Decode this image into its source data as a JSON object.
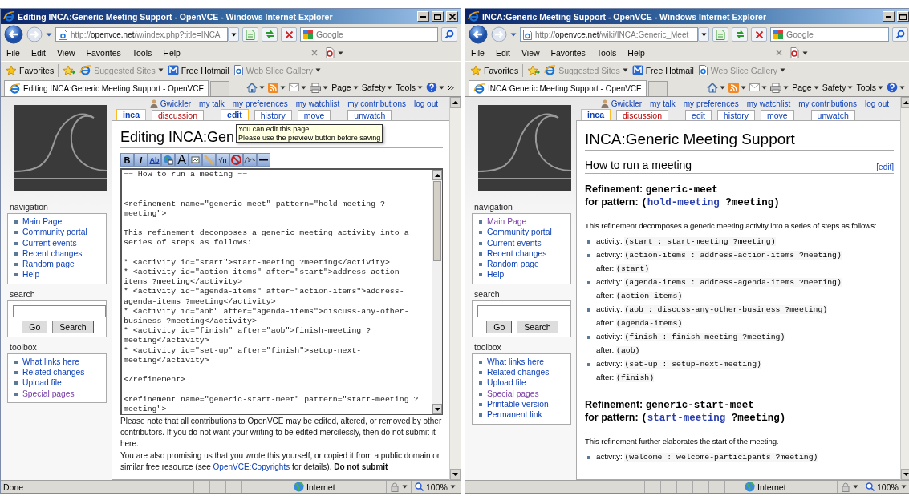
{
  "windows": [
    {
      "kind": "edit",
      "title": "Editing INCA:Generic Meeting Support - OpenVCE - Windows Internet Explorer",
      "address": {
        "prefix": "http://",
        "host": "openvce.net",
        "path": "/w/index.php?title=INCA"
      },
      "search_placeholder": "Google",
      "menu": [
        "File",
        "Edit",
        "View",
        "Favorites",
        "Tools",
        "Help"
      ],
      "favorites": "Favorites",
      "favorite_links": [
        {
          "kind": "suggested",
          "label": "Suggested Sites",
          "disabled": true
        },
        {
          "kind": "hotmail",
          "label": "Free Hotmail",
          "disabled": false
        },
        {
          "kind": "webslice",
          "label": "Web Slice Gallery",
          "disabled": true
        }
      ],
      "tab_title": "Editing INCA:Generic Meeting Support - OpenVCE",
      "commands": [
        "Page",
        "Safety",
        "Tools"
      ],
      "user_links": [
        "Gwickler",
        "my talk",
        "my preferences",
        "my watchlist",
        "my contributions",
        "log out"
      ],
      "page_tabs": [
        {
          "label": "inca",
          "selected": true,
          "new": false
        },
        {
          "label": "discussion",
          "selected": false,
          "new": true
        },
        {
          "label": "edit",
          "selected": true,
          "new": false
        },
        {
          "label": "history",
          "selected": false,
          "new": false
        },
        {
          "label": "move",
          "selected": false,
          "new": false
        },
        {
          "label": "unwatch",
          "selected": false,
          "new": false
        }
      ],
      "heading": "Editing INCA:Gen",
      "tooltip": [
        "You can edit this page.",
        "Please use the preview button before saving"
      ],
      "toolbar": [
        {
          "kind": "bold",
          "glyph": "B"
        },
        {
          "kind": "italic",
          "glyph": "I"
        },
        {
          "kind": "link",
          "glyph": "Ab"
        },
        {
          "kind": "extlink"
        },
        {
          "kind": "headline",
          "glyph": "A"
        },
        {
          "kind": "image"
        },
        {
          "kind": "media"
        },
        {
          "kind": "math",
          "glyph": "√n"
        },
        {
          "kind": "nowiki"
        },
        {
          "kind": "signature"
        },
        {
          "kind": "rule"
        }
      ],
      "editor_paragraphs": [
        {
          "kind": "heading",
          "lines": [
            "== How to run a meeting =="
          ]
        },
        {
          "kind": "block",
          "lines": [
            "<refinement name=\"generic-meet\" pattern=\"hold-meeting ?",
            "meeting\">"
          ]
        },
        {
          "kind": "block",
          "lines": [
            "This refinement decomposes a generic meeting activity into a",
            "series of steps as follows:"
          ]
        },
        {
          "kind": "block",
          "lines": [
            "* <activity id=\"start\">start-meeting ?meeting</activity>",
            "* <activity id=\"action-items\" after=\"start\">address-action-",
            "items ?meeting</activity>",
            "* <activity id=\"agenda-items\" after=\"action-items\">address-",
            "agenda-items ?meeting</activity>",
            "* <activity id=\"aob\" after=\"agenda-items\">discuss-any-other-",
            "business ?meeting</activity>",
            "* <activity id=\"finish\" after=\"aob\">finish-meeting ?",
            "meeting</activity>",
            "* <activity id=\"set-up\" after=\"finish\">setup-next-",
            "meeting</activity>"
          ]
        },
        {
          "kind": "block",
          "lines": [
            "</refinement>"
          ]
        },
        {
          "kind": "block",
          "lines": [
            "<refinement name=\"generic-start-meet\" pattern=\"start-meeting ?",
            "meeting\">"
          ]
        }
      ],
      "notice": [
        {
          "text": "Please note that all contributions to OpenVCE may be edited, altered, or removed by other contributors. If you do not want your writing to be edited mercilessly, then do not submit it here."
        },
        {
          "text": "You are also promising us that you wrote this yourself, or copied it from a public domain or similar free resource (see ",
          "link": "OpenVCE:Copyrights",
          "after": " for details). **Do not submit**"
        }
      ],
      "sidebar": {
        "navigation": {
          "title": "navigation",
          "items": [
            {
              "label": "Main Page",
              "visited": false
            },
            {
              "label": "Community portal",
              "visited": false
            },
            {
              "label": "Current events",
              "visited": false
            },
            {
              "label": "Recent changes",
              "visited": false
            },
            {
              "label": "Random page",
              "visited": false
            },
            {
              "label": "Help",
              "visited": false
            }
          ]
        },
        "search": {
          "title": "search",
          "buttons": [
            "Go",
            "Search"
          ]
        },
        "toolbox": {
          "title": "toolbox",
          "items": [
            {
              "label": "What links here",
              "visited": false
            },
            {
              "label": "Related changes",
              "visited": false
            },
            {
              "label": "Upload file",
              "visited": false
            },
            {
              "label": "Special pages",
              "visited": true
            }
          ]
        }
      },
      "status": {
        "text": "Done",
        "zone": "Internet",
        "zoom": "100%"
      }
    },
    {
      "kind": "article",
      "title": "INCA:Generic Meeting Support - OpenVCE - Windows Internet Explorer",
      "address": {
        "prefix": "http://",
        "host": "openvce.net",
        "path": "/wiki/INCA:Generic_Meet"
      },
      "search_placeholder": "Google",
      "menu": [
        "File",
        "Edit",
        "View",
        "Favorites",
        "Tools",
        "Help"
      ],
      "favorites": "Favorites",
      "favorite_links": [
        {
          "kind": "suggested",
          "label": "Suggested Sites",
          "disabled": true
        },
        {
          "kind": "hotmail",
          "label": "Free Hotmail",
          "disabled": false
        },
        {
          "kind": "webslice",
          "label": "Web Slice Gallery",
          "disabled": true
        }
      ],
      "tab_title": "INCA:Generic Meeting Support - OpenVCE",
      "commands": [
        "Page",
        "Safety",
        "Tools"
      ],
      "user_links": [
        "Gwickler",
        "my talk",
        "my preferences",
        "my watchlist",
        "my contributions",
        "log out"
      ],
      "page_tabs": [
        {
          "label": "inca",
          "selected": true,
          "new": false
        },
        {
          "label": "discussion",
          "selected": false,
          "new": true
        },
        {
          "label": "edit",
          "selected": false,
          "new": false
        },
        {
          "label": "history",
          "selected": false,
          "new": false
        },
        {
          "label": "move",
          "selected": false,
          "new": false
        },
        {
          "label": "unwatch",
          "selected": false,
          "new": false
        }
      ],
      "heading": "INCA:Generic Meeting Support",
      "section": {
        "title": "How to run a meeting",
        "edit": "[edit]"
      },
      "refinements": [
        {
          "label": "Refinement:",
          "name": "generic-meet",
          "pattern_label": "for pattern:",
          "pattern": {
            "before": "(",
            "link": "hold-meeting",
            "after": " ?meeting)"
          },
          "description": "This refinement decomposes a generic meeting activity into a series of steps as follows:",
          "activities": [
            {
              "label": "activity:",
              "value": "(start : start-meeting ?meeting)"
            },
            {
              "label": "activity:",
              "value": "(action-items : address-action-items ?meeting)",
              "after_label": "after:",
              "after": "(start)"
            },
            {
              "label": "activity:",
              "value": "(agenda-items : address-agenda-items ?meeting)",
              "after_label": "after:",
              "after": "(action-items)"
            },
            {
              "label": "activity:",
              "value": "(aob : discuss-any-other-business ?meeting)",
              "after_label": "after:",
              "after": "(agenda-items)"
            },
            {
              "label": "activity:",
              "value": "(finish : finish-meeting ?meeting)",
              "after_label": "after:",
              "after": "(aob)"
            },
            {
              "label": "activity:",
              "value": "(set-up : setup-next-meeting)",
              "after_label": "after:",
              "after": "(finish)"
            }
          ]
        },
        {
          "label": "Refinement:",
          "name": "generic-start-meet",
          "pattern_label": "for pattern:",
          "pattern": {
            "before": "(",
            "link": "start-meeting",
            "after": " ?meeting)"
          },
          "description": "This refinement further elaborates the start of the meeting.",
          "activities": [
            {
              "label": "activity:",
              "value": "(welcome : welcome-participants ?meeting)"
            }
          ]
        }
      ],
      "sidebar": {
        "navigation": {
          "title": "navigation",
          "items": [
            {
              "label": "Main Page",
              "visited": true
            },
            {
              "label": "Community portal",
              "visited": false
            },
            {
              "label": "Current events",
              "visited": false
            },
            {
              "label": "Recent changes",
              "visited": false
            },
            {
              "label": "Random page",
              "visited": false
            },
            {
              "label": "Help",
              "visited": false
            }
          ]
        },
        "search": {
          "title": "search",
          "buttons": [
            "Go",
            "Search"
          ]
        },
        "toolbox": {
          "title": "toolbox",
          "items": [
            {
              "label": "What links here",
              "visited": false
            },
            {
              "label": "Related changes",
              "visited": false
            },
            {
              "label": "Upload file",
              "visited": false
            },
            {
              "label": "Special pages",
              "visited": true
            },
            {
              "label": "Printable version",
              "visited": false
            },
            {
              "label": "Permanent link",
              "visited": false
            }
          ]
        }
      },
      "status": {
        "zone": "Internet",
        "zoom": "100%"
      }
    }
  ]
}
